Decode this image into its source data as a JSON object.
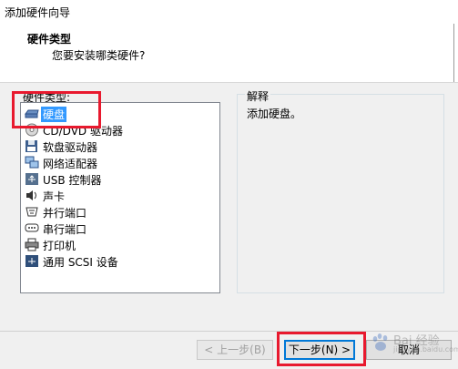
{
  "window": {
    "title": "添加硬件向导"
  },
  "header": {
    "title": "硬件类型",
    "subtitle": "您要安装哪类硬件?"
  },
  "hardware": {
    "label": "硬件类型:",
    "items": [
      {
        "label": "硬盘",
        "icon": "hard-disk-icon",
        "selected": true
      },
      {
        "label": "CD/DVD 驱动器",
        "icon": "cd-dvd-icon"
      },
      {
        "label": "软盘驱动器",
        "icon": "floppy-icon"
      },
      {
        "label": "网络适配器",
        "icon": "network-adapter-icon"
      },
      {
        "label": "USB 控制器",
        "icon": "usb-icon"
      },
      {
        "label": "声卡",
        "icon": "sound-icon"
      },
      {
        "label": "并行端口",
        "icon": "parallel-port-icon"
      },
      {
        "label": "串行端口",
        "icon": "serial-port-icon"
      },
      {
        "label": "打印机",
        "icon": "printer-icon"
      },
      {
        "label": "通用 SCSI 设备",
        "icon": "scsi-icon"
      }
    ]
  },
  "description": {
    "label": "解释",
    "text": "添加硬盘。"
  },
  "buttons": {
    "back": "< 上一步(B)",
    "next": "下一步(N) >",
    "cancel": "取消"
  },
  "watermark": {
    "text": "Bai 经验",
    "url": "jingyan.baidu.com"
  },
  "colors": {
    "selection": "#3399ff",
    "highlight": "#e8192e",
    "default_button": "#0078d7"
  }
}
